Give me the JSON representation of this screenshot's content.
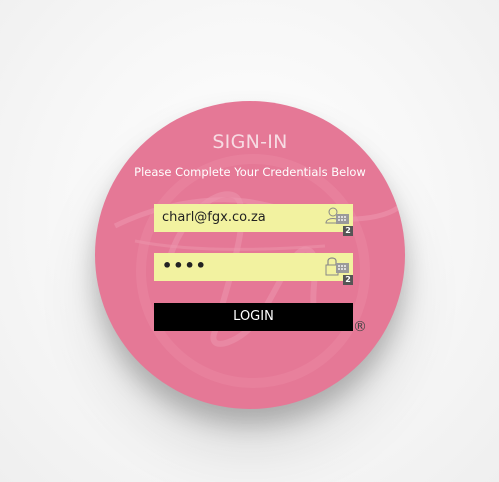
{
  "login_form": {
    "title": "SIGN-IN",
    "subtitle": "Please Complete Your Credentials Below",
    "email_value": "charl@fgx.co.za",
    "email_icon": "person-keypad-icon",
    "email_badge": "2",
    "password_value": "••••",
    "password_icon": "lock-keypad-icon",
    "password_badge": "2",
    "login_label": "LOGIN",
    "registered_mark": "®"
  },
  "colors": {
    "circle": "#e57896",
    "field_background": "#f2f2a0",
    "button_background": "#000000",
    "button_text": "#ffffff"
  }
}
